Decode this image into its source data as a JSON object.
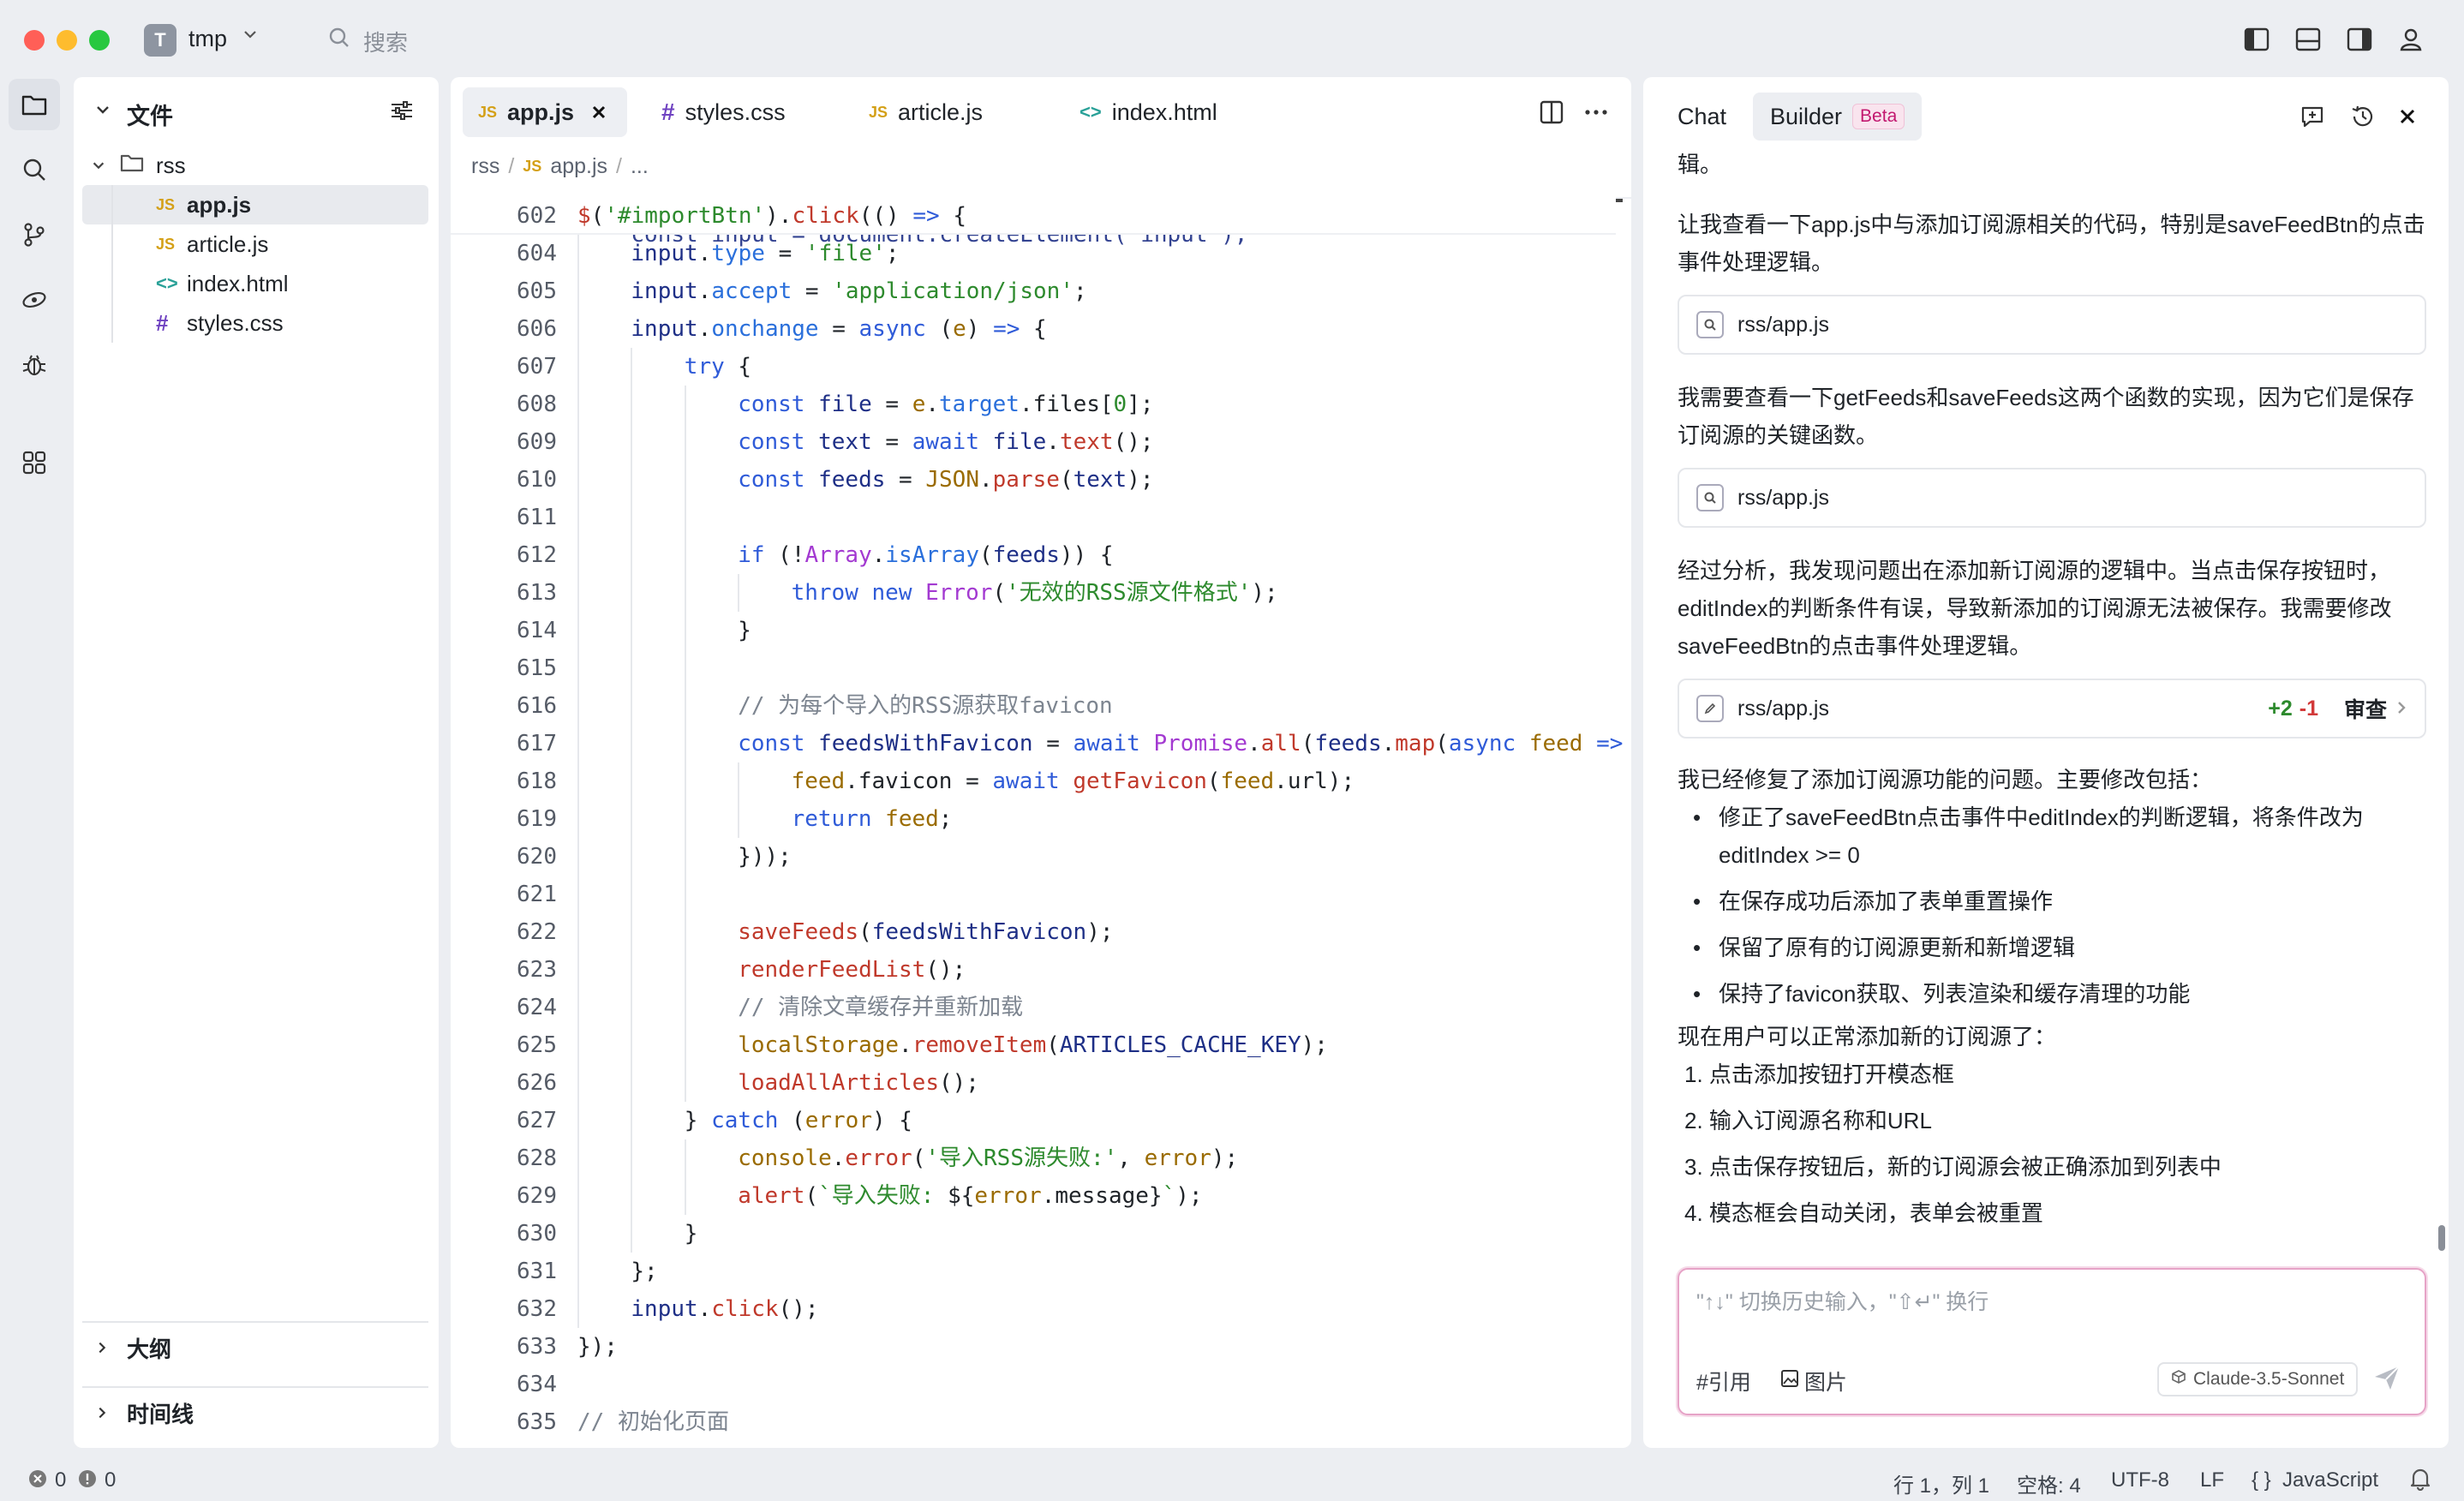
{
  "window": {
    "project_initial": "T",
    "project_name": "tmp",
    "search_label": "搜索"
  },
  "explorer": {
    "title": "文件",
    "folder": "rss",
    "files": [
      {
        "icon": "JS",
        "name": "app.js",
        "selected": true
      },
      {
        "icon": "JS",
        "name": "article.js",
        "selected": false
      },
      {
        "icon": "<>",
        "name": "index.html",
        "selected": false
      },
      {
        "icon": "#",
        "name": "styles.css",
        "selected": false
      }
    ],
    "outline_label": "大纲",
    "timeline_label": "时间线"
  },
  "editor": {
    "tabs": [
      {
        "icon": "JS",
        "label": "app.js",
        "active": true
      },
      {
        "icon": "#",
        "label": "styles.css",
        "active": false
      },
      {
        "icon": "JS",
        "label": "article.js",
        "active": false
      },
      {
        "icon": "<>",
        "label": "index.html",
        "active": false
      }
    ],
    "breadcrumb": [
      "rss",
      "/",
      "JS",
      "app.js",
      "/",
      "..."
    ],
    "lines": [
      {
        "n": "602",
        "indent": 0,
        "tokens": [
          [
            "jq",
            "$"
          ],
          [
            "pl",
            "("
          ],
          [
            "str",
            "'#importBtn'"
          ],
          [
            "pl",
            ")."
          ],
          [
            "fn",
            "click"
          ],
          [
            "pl",
            "(() "
          ],
          [
            "kw",
            "=>"
          ],
          [
            "pl",
            " {"
          ]
        ]
      },
      {
        "n": "604",
        "indent": 1,
        "tokens": [
          [
            "var",
            "input"
          ],
          [
            "pl",
            "."
          ],
          [
            "prop",
            "type"
          ],
          [
            "pl",
            " = "
          ],
          [
            "str",
            "'file'"
          ],
          [
            "pl",
            ";"
          ]
        ]
      },
      {
        "n": "605",
        "indent": 1,
        "tokens": [
          [
            "var",
            "input"
          ],
          [
            "pl",
            "."
          ],
          [
            "prop",
            "accept"
          ],
          [
            "pl",
            " = "
          ],
          [
            "str",
            "'application/json'"
          ],
          [
            "pl",
            ";"
          ]
        ]
      },
      {
        "n": "606",
        "indent": 1,
        "tokens": [
          [
            "var",
            "input"
          ],
          [
            "pl",
            "."
          ],
          [
            "prop",
            "onchange"
          ],
          [
            "pl",
            " = "
          ],
          [
            "kw",
            "async"
          ],
          [
            "pl",
            " ("
          ],
          [
            "par",
            "e"
          ],
          [
            "pl",
            ") "
          ],
          [
            "kw",
            "=>"
          ],
          [
            "pl",
            " {"
          ]
        ]
      },
      {
        "n": "607",
        "indent": 2,
        "tokens": [
          [
            "kw",
            "try"
          ],
          [
            "pl",
            " {"
          ]
        ]
      },
      {
        "n": "608",
        "indent": 3,
        "tokens": [
          [
            "kw",
            "const"
          ],
          [
            "pl",
            " "
          ],
          [
            "var",
            "file"
          ],
          [
            "pl",
            " = "
          ],
          [
            "par",
            "e"
          ],
          [
            "pl",
            "."
          ],
          [
            "prop",
            "target"
          ],
          [
            "pl",
            ".files["
          ],
          [
            "str",
            "0"
          ],
          [
            "pl",
            "];"
          ]
        ]
      },
      {
        "n": "609",
        "indent": 3,
        "tokens": [
          [
            "kw",
            "const"
          ],
          [
            "pl",
            " "
          ],
          [
            "var",
            "text"
          ],
          [
            "pl",
            " = "
          ],
          [
            "kw",
            "await"
          ],
          [
            "pl",
            " "
          ],
          [
            "var",
            "file"
          ],
          [
            "pl",
            "."
          ],
          [
            "fn",
            "text"
          ],
          [
            "pl",
            "();"
          ]
        ]
      },
      {
        "n": "610",
        "indent": 3,
        "tokens": [
          [
            "kw",
            "const"
          ],
          [
            "pl",
            " "
          ],
          [
            "var",
            "feeds"
          ],
          [
            "pl",
            " = "
          ],
          [
            "par",
            "JSON"
          ],
          [
            "pl",
            "."
          ],
          [
            "fn",
            "parse"
          ],
          [
            "pl",
            "("
          ],
          [
            "var",
            "text"
          ],
          [
            "pl",
            ");"
          ]
        ]
      },
      {
        "n": "611",
        "indent": 3,
        "tokens": []
      },
      {
        "n": "612",
        "indent": 3,
        "tokens": [
          [
            "kw",
            "if"
          ],
          [
            "pl",
            " (!"
          ],
          [
            "cls",
            "Array"
          ],
          [
            "pl",
            "."
          ],
          [
            "prop",
            "isArray"
          ],
          [
            "pl",
            "("
          ],
          [
            "var",
            "feeds"
          ],
          [
            "pl",
            ")) {"
          ]
        ]
      },
      {
        "n": "613",
        "indent": 4,
        "tokens": [
          [
            "kw",
            "throw"
          ],
          [
            "pl",
            " "
          ],
          [
            "kw",
            "new"
          ],
          [
            "pl",
            " "
          ],
          [
            "cls",
            "Error"
          ],
          [
            "pl",
            "("
          ],
          [
            "str",
            "'无效的RSS源文件格式'"
          ],
          [
            "pl",
            ");"
          ]
        ]
      },
      {
        "n": "614",
        "indent": 3,
        "tokens": [
          [
            "pl",
            "}"
          ]
        ]
      },
      {
        "n": "615",
        "indent": 3,
        "tokens": []
      },
      {
        "n": "616",
        "indent": 3,
        "tokens": [
          [
            "cm",
            "// 为每个导入的RSS源获取favicon"
          ]
        ]
      },
      {
        "n": "617",
        "indent": 3,
        "tokens": [
          [
            "kw",
            "const"
          ],
          [
            "pl",
            " "
          ],
          [
            "var",
            "feedsWithFavicon"
          ],
          [
            "pl",
            " = "
          ],
          [
            "kw",
            "await"
          ],
          [
            "pl",
            " "
          ],
          [
            "cls",
            "Promise"
          ],
          [
            "pl",
            "."
          ],
          [
            "fn",
            "all"
          ],
          [
            "pl",
            "("
          ],
          [
            "var",
            "feeds"
          ],
          [
            "pl",
            "."
          ],
          [
            "fn",
            "map"
          ],
          [
            "pl",
            "("
          ],
          [
            "kw",
            "async"
          ],
          [
            "pl",
            " "
          ],
          [
            "par",
            "feed"
          ],
          [
            "pl",
            " "
          ],
          [
            "kw",
            "=>"
          ]
        ]
      },
      {
        "n": "618",
        "indent": 4,
        "tokens": [
          [
            "par",
            "feed"
          ],
          [
            "pl",
            ".favicon = "
          ],
          [
            "kw",
            "await"
          ],
          [
            "pl",
            " "
          ],
          [
            "fn",
            "getFavicon"
          ],
          [
            "pl",
            "("
          ],
          [
            "par",
            "feed"
          ],
          [
            "pl",
            ".url);"
          ]
        ]
      },
      {
        "n": "619",
        "indent": 4,
        "tokens": [
          [
            "kw",
            "return"
          ],
          [
            "pl",
            " "
          ],
          [
            "par",
            "feed"
          ],
          [
            "pl",
            ";"
          ]
        ]
      },
      {
        "n": "620",
        "indent": 3,
        "tokens": [
          [
            "pl",
            "}));"
          ]
        ]
      },
      {
        "n": "621",
        "indent": 3,
        "tokens": []
      },
      {
        "n": "622",
        "indent": 3,
        "tokens": [
          [
            "fn",
            "saveFeeds"
          ],
          [
            "pl",
            "("
          ],
          [
            "var",
            "feedsWithFavicon"
          ],
          [
            "pl",
            ");"
          ]
        ]
      },
      {
        "n": "623",
        "indent": 3,
        "tokens": [
          [
            "fn",
            "renderFeedList"
          ],
          [
            "pl",
            "();"
          ]
        ]
      },
      {
        "n": "624",
        "indent": 3,
        "tokens": [
          [
            "cm",
            "// 清除文章缓存并重新加载"
          ]
        ]
      },
      {
        "n": "625",
        "indent": 3,
        "tokens": [
          [
            "par",
            "localStorage"
          ],
          [
            "pl",
            "."
          ],
          [
            "fn",
            "removeItem"
          ],
          [
            "pl",
            "("
          ],
          [
            "var",
            "ARTICLES_CACHE_KEY"
          ],
          [
            "pl",
            ");"
          ]
        ]
      },
      {
        "n": "626",
        "indent": 3,
        "tokens": [
          [
            "fn",
            "loadAllArticles"
          ],
          [
            "pl",
            "();"
          ]
        ]
      },
      {
        "n": "627",
        "indent": 2,
        "tokens": [
          [
            "pl",
            "} "
          ],
          [
            "kw",
            "catch"
          ],
          [
            "pl",
            " ("
          ],
          [
            "par",
            "error"
          ],
          [
            "pl",
            ") {"
          ]
        ]
      },
      {
        "n": "628",
        "indent": 3,
        "tokens": [
          [
            "par",
            "console"
          ],
          [
            "pl",
            "."
          ],
          [
            "fn",
            "error"
          ],
          [
            "pl",
            "("
          ],
          [
            "str",
            "'导入RSS源失败:'"
          ],
          [
            "pl",
            ", "
          ],
          [
            "par",
            "error"
          ],
          [
            "pl",
            ");"
          ]
        ]
      },
      {
        "n": "629",
        "indent": 3,
        "tokens": [
          [
            "fn",
            "alert"
          ],
          [
            "pl",
            "("
          ],
          [
            "str",
            "`导入失败: "
          ],
          [
            "pl",
            "${"
          ],
          [
            "par",
            "error"
          ],
          [
            "pl",
            ".message}"
          ],
          [
            "str",
            "`"
          ],
          [
            "pl",
            ");"
          ]
        ]
      },
      {
        "n": "630",
        "indent": 2,
        "tokens": [
          [
            "pl",
            "}"
          ]
        ]
      },
      {
        "n": "631",
        "indent": 1,
        "tokens": [
          [
            "pl",
            "};"
          ]
        ]
      },
      {
        "n": "632",
        "indent": 1,
        "tokens": [
          [
            "var",
            "input"
          ],
          [
            "pl",
            "."
          ],
          [
            "fn",
            "click"
          ],
          [
            "pl",
            "();"
          ]
        ]
      },
      {
        "n": "633",
        "indent": 0,
        "tokens": [
          [
            "pl",
            "});"
          ]
        ]
      },
      {
        "n": "634",
        "indent": 0,
        "tokens": []
      },
      {
        "n": "635",
        "indent": 0,
        "tokens": [
          [
            "cm",
            "// 初始化页面"
          ]
        ]
      }
    ],
    "partial_line": "const input = document.createElement('input');"
  },
  "chat": {
    "tab_chat": "Chat",
    "tab_builder": "Builder",
    "beta_badge": "Beta",
    "msg_top_fragment": "辑。",
    "msg1": "让我查看一下app.js中与添加订阅源相关的代码，特别是saveFeedBtn的点击事件处理逻辑。",
    "card1": "rss/app.js",
    "msg2": "我需要查看一下getFeeds和saveFeeds这两个函数的实现，因为它们是保存订阅源的关键函数。",
    "card2": "rss/app.js",
    "msg3": "经过分析，我发现问题出在添加新订阅源的逻辑中。当点击保存按钮时，editIndex的判断条件有误，导致新添加的订阅源无法被保存。我需要修改saveFeedBtn的点击事件处理逻辑。",
    "card3": {
      "file": "rss/app.js",
      "added": "+2",
      "removed": "-1",
      "review": "审查"
    },
    "msg4_intro": "我已经修复了添加订阅源功能的问题。主要修改包括：",
    "bullets": [
      "修正了saveFeedBtn点击事件中editIndex的判断逻辑，将条件改为editIndex >= 0",
      "在保存成功后添加了表单重置操作",
      "保留了原有的订阅源更新和新增逻辑",
      "保持了favicon获取、列表渲染和缓存清理的功能"
    ],
    "steps_intro": "现在用户可以正常添加新的订阅源了：",
    "steps": [
      "1. 点击添加按钮打开模态框",
      "2. 输入订阅源名称和URL",
      "3. 点击保存按钮后，新的订阅源会被正确添加到列表中",
      "4. 模态框会自动关闭，表单会被重置"
    ],
    "input_placeholder": "\"↑↓\" 切换历史输入，\"⇧↵\" 换行",
    "btn_reference": "#引用",
    "btn_image": "图片",
    "model": "Claude-3.5-Sonnet"
  },
  "status": {
    "errors": "0",
    "warnings": "0",
    "position": "行 1，列 1",
    "spaces": "空格: 4",
    "encoding": "UTF-8",
    "eol": "LF",
    "language": "JavaScript"
  }
}
